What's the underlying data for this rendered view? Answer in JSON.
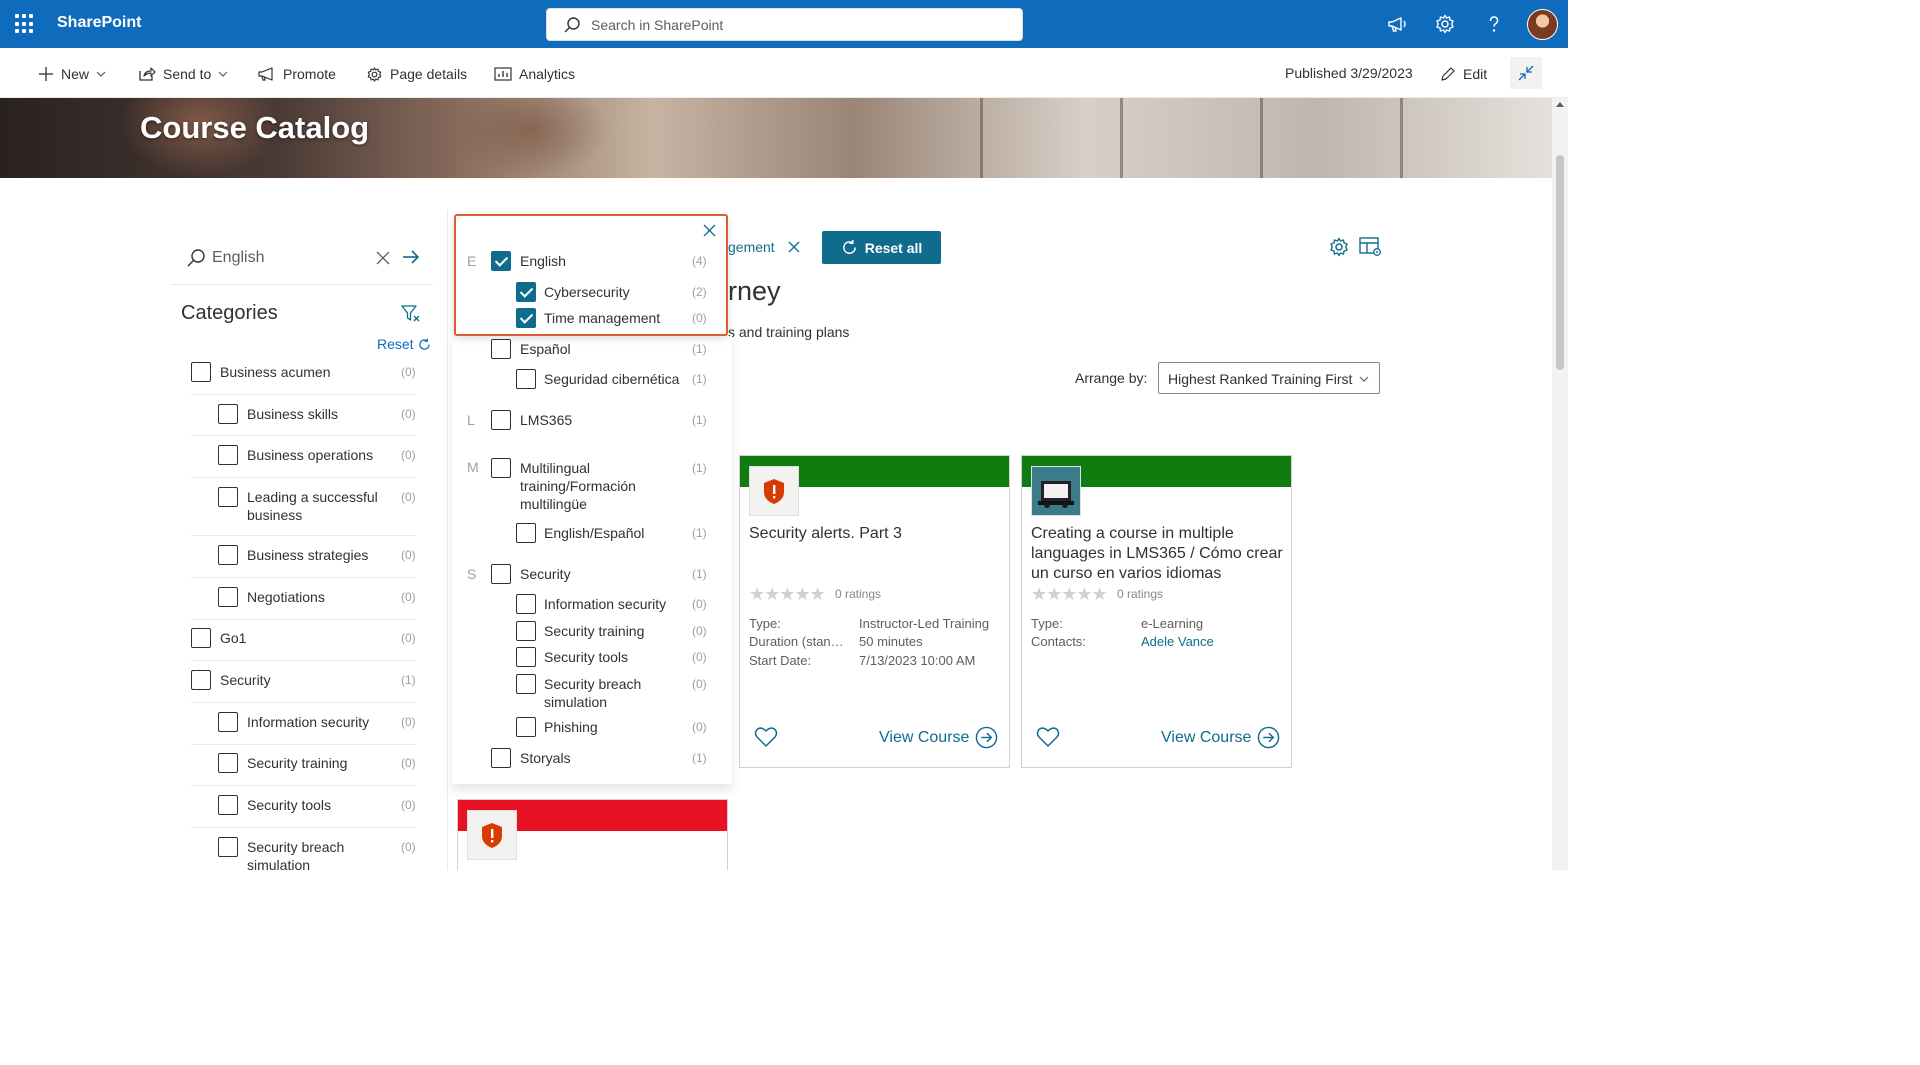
{
  "suite": {
    "app_name": "SharePoint",
    "search_placeholder": "Search in SharePoint"
  },
  "commandbar": {
    "new_label": "New",
    "send_to_label": "Send to",
    "promote_label": "Promote",
    "page_details_label": "Page details",
    "analytics_label": "Analytics",
    "published_label": "Published 3/29/2023",
    "edit_label": "Edit"
  },
  "hero": {
    "title": "Course Catalog"
  },
  "filter_search": {
    "value": "English"
  },
  "categories": {
    "title": "Categories",
    "reset_label": "Reset",
    "items": [
      {
        "label": "Business acumen",
        "count": "(0)",
        "level": 0
      },
      {
        "label": "Business skills",
        "count": "(0)",
        "level": 1
      },
      {
        "label": "Business operations",
        "count": "(0)",
        "level": 1
      },
      {
        "label": "Leading a successful business",
        "count": "(0)",
        "level": 1
      },
      {
        "label": "Business strategies",
        "count": "(0)",
        "level": 1
      },
      {
        "label": "Negotiations",
        "count": "(0)",
        "level": 1
      },
      {
        "label": "Go1",
        "count": "(0)",
        "level": 0
      },
      {
        "label": "Security",
        "count": "(1)",
        "level": 0
      },
      {
        "label": "Information security",
        "count": "(0)",
        "level": 1
      },
      {
        "label": "Security training",
        "count": "(0)",
        "level": 1
      },
      {
        "label": "Security tools",
        "count": "(0)",
        "level": 1
      },
      {
        "label": "Security breach simulation",
        "count": "(0)",
        "level": 1
      }
    ]
  },
  "popup": {
    "items": [
      {
        "letter": "E",
        "label": "English",
        "count": "(4)",
        "checked": true
      },
      {
        "label": "Cybersecurity",
        "count": "(2)",
        "checked": true
      },
      {
        "label": "Time management",
        "count": "(0)",
        "checked": true
      },
      {
        "label": "Español",
        "count": "(1)",
        "checked": false
      },
      {
        "label": "Seguridad cibernética",
        "count": "(1)",
        "checked": false
      },
      {
        "letter": "L",
        "label": "LMS365",
        "count": "(1)",
        "checked": false
      },
      {
        "letter": "M",
        "label": "Multilingual training/Formación multilingüe",
        "count": "(1)",
        "checked": false
      },
      {
        "label": "English/Español",
        "count": "(1)",
        "checked": false
      },
      {
        "letter": "S",
        "label": "Security",
        "count": "(1)",
        "checked": false
      },
      {
        "label": "Information security",
        "count": "(0)",
        "checked": false
      },
      {
        "label": "Security training",
        "count": "(0)",
        "checked": false
      },
      {
        "label": "Security tools",
        "count": "(0)",
        "checked": false
      },
      {
        "label": "Security breach simulation",
        "count": "(0)",
        "checked": false
      },
      {
        "label": "Phishing",
        "count": "(0)",
        "checked": false
      },
      {
        "label": "Storyals",
        "count": "(1)",
        "checked": false
      }
    ]
  },
  "main": {
    "chip_label": "gement",
    "reset_all_label": "Reset all",
    "heading_fragment": "rney",
    "sub_fragment": "s and training plans",
    "arrange_label": "Arrange by:",
    "arrange_value": "Highest Ranked Training First"
  },
  "cards": [
    {
      "title": "Security alerts. Part 3",
      "stars": "★★★★★",
      "ratings": "0 ratings",
      "band_color": "#107c10",
      "meta": [
        {
          "label": "Type:",
          "value": "Instructor-Led Training"
        },
        {
          "label": "Duration (standard):",
          "value": "50 minutes"
        },
        {
          "label": "Start Date:",
          "value": "7/13/2023 10:00 AM"
        }
      ],
      "view_label": "View Course"
    },
    {
      "title": "Creating a course in multiple languages in LMS365 / Cómo crear un curso en varios idiomas",
      "stars": "★★★★★",
      "ratings": "0 ratings",
      "band_color": "#107c10",
      "meta": [
        {
          "label": "Type:",
          "value": "e-Learning"
        },
        {
          "label": "Contacts:",
          "value": "Adele Vance"
        }
      ],
      "view_label": "View Course"
    }
  ],
  "bottom_card": {
    "band_color": "#e81123"
  },
  "colors": {
    "suite_blue": "#0f6cbd",
    "teal_accent": "#0f6c8d",
    "popup_outline": "#e05a35"
  }
}
